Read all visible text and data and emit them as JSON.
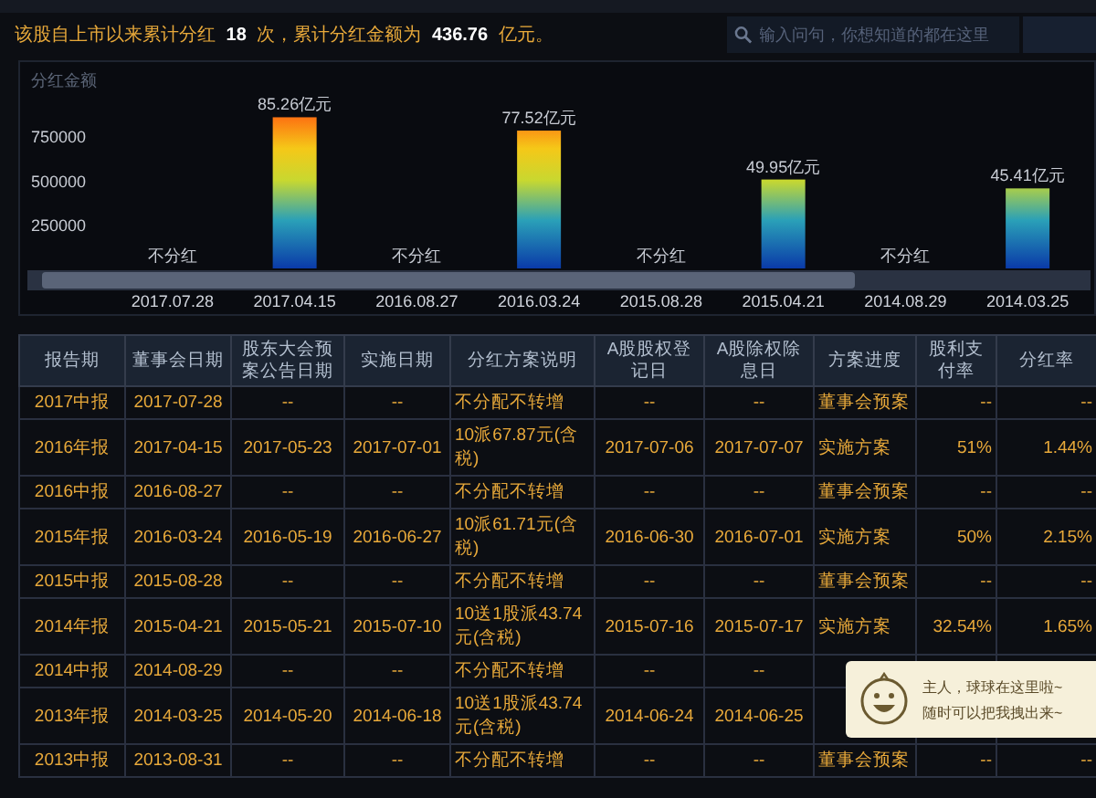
{
  "header": {
    "summary": "该股自上市以来累计分红 **18** 次，累计分红金额为 **436.76** 亿元。"
  },
  "search": {
    "placeholder": "输入问句，你想知道的都在这里"
  },
  "chart": {
    "chart_data": {
      "type": "bar",
      "ylabel": "分红金额",
      "categories": [
        "2017.07.28",
        "2017.04.15",
        "2016.08.27",
        "2016.03.24",
        "2015.08.28",
        "2015.04.21",
        "2014.08.29",
        "2014.03.25"
      ],
      "values": [
        null,
        850000,
        null,
        775000,
        null,
        500000,
        null,
        450000
      ],
      "ylim": [
        0,
        1150000
      ],
      "yticks": [
        250000,
        500000,
        750000
      ],
      "annotations": [
        "不分红",
        "85.26亿元",
        "不分红",
        "77.52亿元",
        "不分红",
        "49.95亿元",
        "不分红",
        "45.41亿元"
      ]
    }
  },
  "table": {
    "columns": [
      "报告期",
      "董事会日期",
      "股东大会预案公告日期",
      "实施日期",
      "分红方案说明",
      "A股股权登记日",
      "A股除权除息日",
      "方案进度",
      "股利支付率",
      "分红率"
    ],
    "rows": [
      [
        "2017中报",
        "2017-07-28",
        "--",
        "--",
        "不分配不转增",
        "--",
        "--",
        "董事会预案",
        "--",
        "--"
      ],
      [
        "2016年报",
        "2017-04-15",
        "2017-05-23",
        "2017-07-01",
        "10派67.87元(含税)",
        "2017-07-06",
        "2017-07-07",
        "实施方案",
        "51%",
        "1.44%"
      ],
      [
        "2016中报",
        "2016-08-27",
        "--",
        "--",
        "不分配不转增",
        "--",
        "--",
        "董事会预案",
        "--",
        "--"
      ],
      [
        "2015年报",
        "2016-03-24",
        "2016-05-19",
        "2016-06-27",
        "10派61.71元(含税)",
        "2016-06-30",
        "2016-07-01",
        "实施方案",
        "50%",
        "2.15%"
      ],
      [
        "2015中报",
        "2015-08-28",
        "--",
        "--",
        "不分配不转增",
        "--",
        "--",
        "董事会预案",
        "--",
        "--"
      ],
      [
        "2014年报",
        "2015-04-21",
        "2015-05-21",
        "2015-07-10",
        "10送1股派43.74元(含税)",
        "2015-07-16",
        "2015-07-17",
        "实施方案",
        "32.54%",
        "1.65%"
      ],
      [
        "2014中报",
        "2014-08-29",
        "--",
        "--",
        "不分配不转增",
        "--",
        "--",
        null,
        null,
        null
      ],
      [
        "2013年报",
        "2014-03-25",
        "2014-05-20",
        "2014-06-18",
        "10送1股派43.74元(含税)",
        "2014-06-24",
        "2014-06-25",
        null,
        null,
        null
      ],
      [
        "2013中报",
        "2013-08-31",
        "--",
        "--",
        "不分配不转增",
        "--",
        "--",
        "董事会预案",
        "--",
        "--"
      ]
    ]
  },
  "popup": {
    "lines": [
      "主人，球球在这里啦~",
      "随时可以把我拽出来~"
    ]
  }
}
